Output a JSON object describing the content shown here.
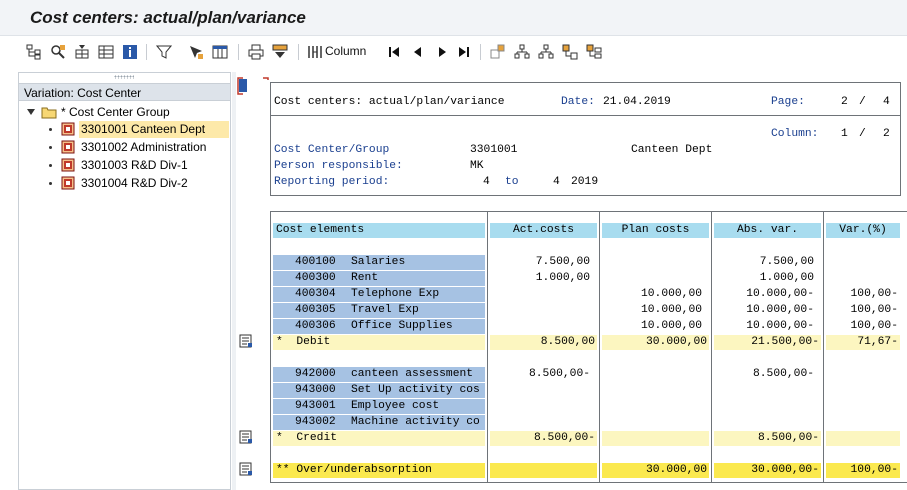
{
  "window": {
    "title": "Cost centers: actual/plan/variance"
  },
  "toolbar": {
    "column_label": "Column",
    "icons": [
      "hierarchy-icon",
      "find-icon",
      "tree-toggle-icon",
      "layout-icon",
      "info-icon",
      "filter-icon",
      "select-icon",
      "columns-icon",
      "print-icon",
      "sort-icon",
      "column-icon",
      "first-page-icon",
      "previous-page-icon",
      "next-page-icon",
      "last-page-icon",
      "expand-icon",
      "collapse-icon",
      "expand-all-icon",
      "collapse-all-icon"
    ]
  },
  "tree": {
    "variation_label": "Variation: Cost Center",
    "group_label": "* Cost Center Group",
    "items": [
      {
        "label": "3301001 Canteen Dept",
        "selected": true
      },
      {
        "label": "3301002 Administration",
        "selected": false
      },
      {
        "label": "3301003 R&D Div-1",
        "selected": false
      },
      {
        "label": "3301004 R&D Div-2",
        "selected": false
      }
    ]
  },
  "report": {
    "title": "Cost centers: actual/plan/variance",
    "date_label": "Date:",
    "date_value": "21.04.2019",
    "page_label": "Page:",
    "page_current": "2",
    "page_sep": "/",
    "page_total": "4",
    "column_label": "Column:",
    "column_current": "1",
    "column_sep": "/",
    "column_total": "2",
    "cc_group_label": "Cost Center/Group",
    "cc_group_value": "3301001",
    "cc_group_name": "Canteen Dept",
    "person_label": "Person responsible:",
    "person_value": "MK",
    "period_label": "Reporting period:",
    "period_from": "4",
    "period_to_label": "to",
    "period_to": "4",
    "period_year": "2019"
  },
  "table": {
    "headers": [
      "Cost elements",
      "Act.costs",
      "Plan costs",
      "Abs. var.",
      "Var.(%)"
    ],
    "debit_rows": [
      {
        "code": "400100",
        "name": "Salaries",
        "act": "7.500,00",
        "plan": "",
        "abs": "7.500,00",
        "pct": ""
      },
      {
        "code": "400300",
        "name": "Rent",
        "act": "1.000,00",
        "plan": "",
        "abs": "1.000,00",
        "pct": ""
      },
      {
        "code": "400304",
        "name": "Telephone Exp",
        "act": "",
        "plan": "10.000,00",
        "abs": "10.000,00-",
        "pct": "100,00-"
      },
      {
        "code": "400305",
        "name": "Travel Exp",
        "act": "",
        "plan": "10.000,00",
        "abs": "10.000,00-",
        "pct": "100,00-"
      },
      {
        "code": "400306",
        "name": "Office Supplies",
        "act": "",
        "plan": "10.000,00",
        "abs": "10.000,00-",
        "pct": "100,00-"
      }
    ],
    "debit_total": {
      "label": "*  Debit",
      "act": "8.500,00",
      "plan": "30.000,00",
      "abs": "21.500,00-",
      "pct": "71,67-"
    },
    "credit_rows": [
      {
        "code": "942000",
        "name": "canteen assessment",
        "act": "8.500,00-",
        "plan": "",
        "abs": "8.500,00-",
        "pct": ""
      },
      {
        "code": "943000",
        "name": "Set Up activity cos",
        "act": "",
        "plan": "",
        "abs": "",
        "pct": ""
      },
      {
        "code": "943001",
        "name": "Employee cost",
        "act": "",
        "plan": "",
        "abs": "",
        "pct": ""
      },
      {
        "code": "943002",
        "name": "Machine activity co",
        "act": "",
        "plan": "",
        "abs": "",
        "pct": ""
      }
    ],
    "credit_total": {
      "label": "*  Credit",
      "act": "8.500,00-",
      "plan": "",
      "abs": "8.500,00-",
      "pct": ""
    },
    "grand_total": {
      "label": "** Over/underabsorption",
      "act": "",
      "plan": "30.000,00",
      "abs": "30.000,00-",
      "pct": "100,00-"
    }
  },
  "colors": {
    "header_cell": "#a8dcef",
    "key_cell": "#a6c2e3",
    "subtotal": "#fcf6c0",
    "total": "#fbe94f",
    "selected_tree": "#fde9a9",
    "label_blue": "#1a3f8f"
  }
}
